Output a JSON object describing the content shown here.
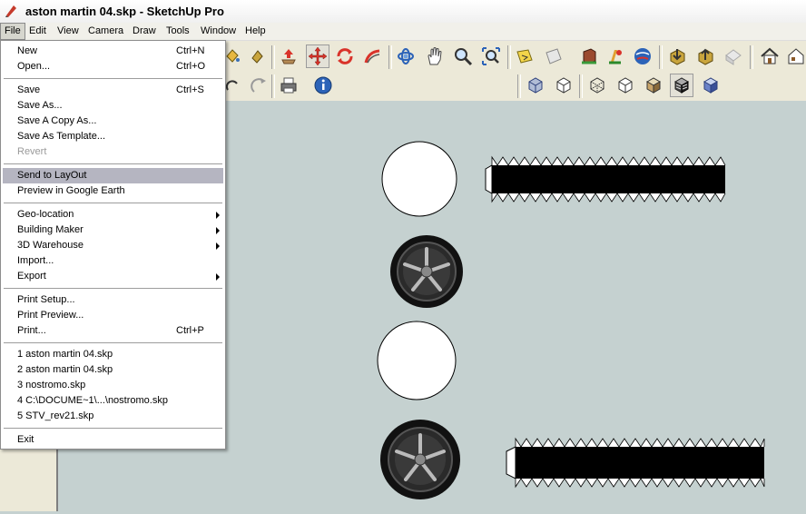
{
  "window": {
    "title": "aston martin 04.skp - SketchUp Pro"
  },
  "menubar": [
    "File",
    "Edit",
    "View",
    "Camera",
    "Draw",
    "Tools",
    "Window",
    "Help"
  ],
  "file_menu": {
    "groups": [
      [
        {
          "label": "New",
          "shortcut": "Ctrl+N"
        },
        {
          "label": "Open...",
          "shortcut": "Ctrl+O"
        }
      ],
      [
        {
          "label": "Save",
          "shortcut": "Ctrl+S"
        },
        {
          "label": "Save As...",
          "shortcut": ""
        },
        {
          "label": "Save A Copy As...",
          "shortcut": ""
        },
        {
          "label": "Save As Template...",
          "shortcut": ""
        },
        {
          "label": "Revert",
          "shortcut": "",
          "disabled": true
        }
      ],
      [
        {
          "label": "Send to LayOut",
          "shortcut": "",
          "highlighted": true
        },
        {
          "label": "Preview in Google Earth",
          "shortcut": ""
        }
      ],
      [
        {
          "label": "Geo-location",
          "shortcut": "",
          "submenu": true
        },
        {
          "label": "Building Maker",
          "shortcut": "",
          "submenu": true
        },
        {
          "label": "3D Warehouse",
          "shortcut": "",
          "submenu": true
        },
        {
          "label": "Import...",
          "shortcut": ""
        },
        {
          "label": "Export",
          "shortcut": "",
          "submenu": true
        }
      ],
      [
        {
          "label": "Print Setup...",
          "shortcut": ""
        },
        {
          "label": "Print Preview...",
          "shortcut": ""
        },
        {
          "label": "Print...",
          "shortcut": "Ctrl+P"
        }
      ],
      [
        {
          "label": "1 aston martin 04.skp",
          "shortcut": ""
        },
        {
          "label": "2 aston martin 04.skp",
          "shortcut": ""
        },
        {
          "label": "3 nostromo.skp",
          "shortcut": ""
        },
        {
          "label": "4 C:\\DOCUME~1\\...\\nostromo.skp",
          "shortcut": ""
        },
        {
          "label": "5 STV_rev21.skp",
          "shortcut": ""
        }
      ],
      [
        {
          "label": "Exit",
          "shortcut": ""
        }
      ]
    ]
  },
  "toolbar_row1": [
    "paint-bucket-icon",
    "push-pull-icon",
    "move-icon",
    "rotate-icon",
    "follow-me-icon",
    "orbit-icon",
    "pan-icon",
    "zoom-icon",
    "zoom-extents-icon",
    "get-current-view-icon",
    "toggle-terrain-icon",
    "place-model-icon",
    "get-models-icon",
    "share-model-icon",
    "get-component-icon",
    "share-component-icon",
    "extension-warehouse-icon",
    "house-icon",
    "house-front-icon"
  ],
  "toolbar_row2": [
    "redo-icon",
    "print-icon",
    "model-info-icon",
    "xray-icon",
    "wireframe-icon",
    "hidden-line-icon",
    "shaded-icon",
    "shaded-textures-icon",
    "monochrome-icon",
    "iso-view-icon"
  ],
  "colors": {
    "viewport_bg": "#c5d1d0",
    "highlight": "#b5b5c1",
    "menu_bg": "#f1f0ea"
  }
}
